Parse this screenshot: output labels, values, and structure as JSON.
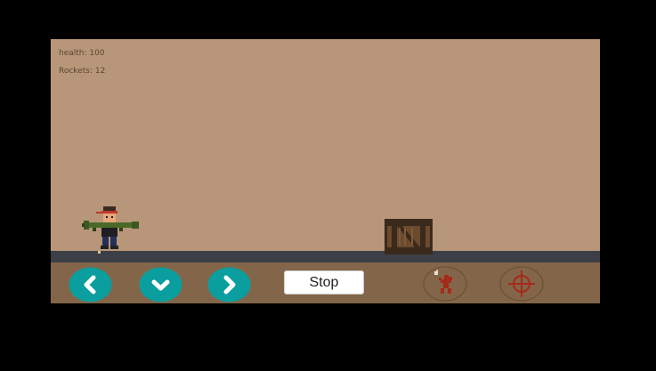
{
  "hud": {
    "health_label": "health: 100",
    "rockets_label": "Rockets: 12"
  },
  "controls": {
    "stop_label": "Stop",
    "left_icon": "chevron-left",
    "down_icon": "chevron-down",
    "right_icon": "chevron-right",
    "throw_icon": "grenade-throw",
    "aim_icon": "crosshair"
  },
  "colors": {
    "frame": "#000000",
    "sky": "#b89679",
    "ground": "#3c3f45",
    "control_bar": "#836649",
    "dpad_button": "#0a9e9e",
    "action_icon": "#a52a1a",
    "crate": "#6b4a2e"
  }
}
